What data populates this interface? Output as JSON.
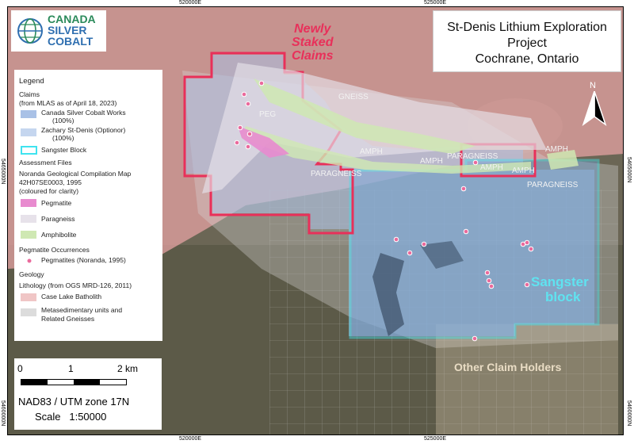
{
  "title": {
    "line1": "St-Denis Lithium Exploration",
    "line2": "Project",
    "line3": "Cochrane, Ontario"
  },
  "logo": {
    "line1": "CANADA",
    "line2": "SILVER",
    "line3": "COBALT",
    "color_canada": "#2a8a5a",
    "color_silver": "#2f6fb0",
    "color_cobalt": "#2f6fb0"
  },
  "coordinates": {
    "top_left_e": "520000E",
    "top_right_e": "525000E",
    "bottom_left_e": "520000E",
    "bottom_right_e": "525000E",
    "left_upper_n": "5465000N",
    "left_lower_n": "5460000N",
    "right_upper_n": "5465000N",
    "right_lower_n": "5460000N"
  },
  "callouts": {
    "new_claims_1": "Newly",
    "new_claims_2": "Staked",
    "new_claims_3": "Claims",
    "sangster_1": "Sangster",
    "sangster_2": "block",
    "other": "Other Claim Holders"
  },
  "map_labels": {
    "gneiss": "GNEISS",
    "peg": "PEG",
    "amph1": "AMPH",
    "amph2": "AMPH",
    "amph3": "AMPH",
    "amph4": "AMPH",
    "amph5": "AMPH",
    "para1": "PARAGNEISS",
    "para2": "PARAGNEISS",
    "para3": "PARAGNEISS"
  },
  "legend": {
    "heading": "Legend",
    "claims_title": "Claims",
    "claims_sub": "(from MLAS as of April 18, 2023)",
    "csc": "Canada Silver Cobalt Works",
    "csc2": "(100%)",
    "zachary": "Zachary St-Denis (Optionor)",
    "zachary2": "(100%)",
    "sangster": "Sangster Block",
    "assess": "Assessment Files",
    "noranda1": "Noranda Geological Compilation Map",
    "noranda2": "42H07SE0003, 1995",
    "noranda3": "(coloured for clarity)",
    "pegmatite": "Pegmatite",
    "paragneiss": "Paragneiss",
    "amphibolite": "Amphibolite",
    "occ_title": "Pegmatite Occurrences",
    "occ_item": "Pegmatites (Noranda, 1995)",
    "geology": "Geology",
    "lith": "Lithology (from OGS MRD-126, 2011)",
    "case_lake": "Case Lake Batholith",
    "meta1": "Metasedimentary units and",
    "meta2": "Related Gneisses"
  },
  "scale": {
    "t0": "0",
    "t1": "1",
    "t2": "2 km",
    "datum": "NAD83 / UTM zone 17N",
    "scale_text": "Scale   1:50000"
  },
  "north": {
    "label": "N",
    "icon": "north-arrow-icon"
  },
  "colors": {
    "batholith": "#e4a3a3",
    "meta": "#d8d8d8",
    "csc_claims": "#a9c1e6",
    "zachary_claims": "#c5d6ef",
    "sangster": "#3fe3ef",
    "new_claims": "#e8305a",
    "pegmatite": "#e88bcf",
    "paragneiss": "#e7e2ea",
    "amphibolite": "#cfe8b3",
    "occurrence": "#ea6a9c"
  }
}
